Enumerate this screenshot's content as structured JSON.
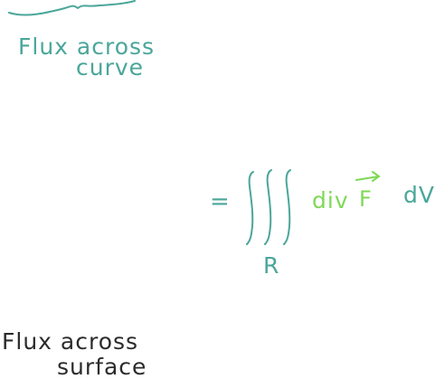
{
  "notes": {
    "top_label_line1": "Flux across",
    "top_label_line2": "curve",
    "equals": "=",
    "region_label": "R",
    "integrand_div": "div",
    "integrand_F": "F",
    "integrand_dV": "dV",
    "bottom_label_line1": "Flux across",
    "bottom_label_line2": "surface"
  },
  "colors": {
    "teal": "#4aa69a",
    "green": "#7ed957",
    "black": "#2b2b2b",
    "background": "#ffffff"
  }
}
